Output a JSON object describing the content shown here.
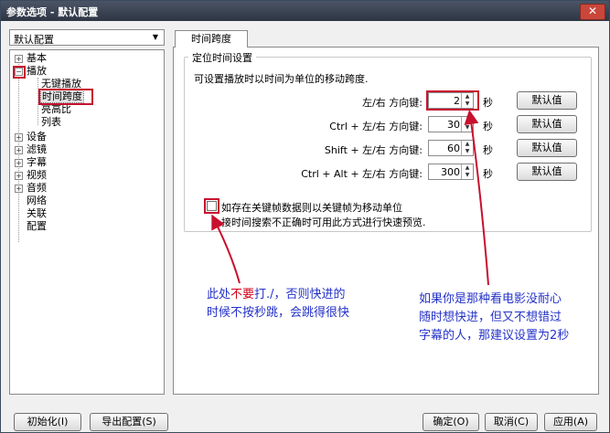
{
  "window": {
    "title": "参数选项 - 默认配置"
  },
  "profile_select": {
    "value": "默认配置"
  },
  "tree": {
    "basic": "基本",
    "playback": "播放",
    "no_keyframe": "无键播放",
    "time_span": "时间跨度",
    "aspect": "亮高比",
    "list": "列表",
    "device": "设备",
    "filter": "滤镜",
    "subtitle": "字幕",
    "video": "视频",
    "audio": "音频",
    "network": "网络",
    "association": "关联",
    "config": "配置"
  },
  "tab": {
    "label": "时间跨度"
  },
  "group": {
    "title": "定位时间设置",
    "description": "可设置播放时以时间为单位的移动跨度.",
    "rows": [
      {
        "label": "左/右 方向键:",
        "value": "2",
        "unit": "秒",
        "button": "默认值"
      },
      {
        "label": "Ctrl + 左/右 方向键:",
        "value": "30",
        "unit": "秒",
        "button": "默认值"
      },
      {
        "label": "Shift + 左/右 方向键:",
        "value": "60",
        "unit": "秒",
        "button": "默认值"
      },
      {
        "label": "Ctrl + Alt + 左/右 方向键:",
        "value": "300",
        "unit": "秒",
        "button": "默认值"
      }
    ],
    "checkbox_label": "如存在关键帧数据则以关键帧为移动单位",
    "checkbox_hint": "接时间搜索不正确时可用此方式进行快速预览."
  },
  "annotations": {
    "left_line1_a": "此处",
    "left_line1_red": "不要",
    "left_line1_b": "打./，否则快进的",
    "left_line2": "时候不按秒跳，会跳得很快",
    "right_line1": "如果你是那种看电影没耐心",
    "right_line2": "随时想快进，但又不想错过",
    "right_line3": "字幕的人，那建议设置为2秒"
  },
  "footer": {
    "init": "初始化(I)",
    "export": "导出配置(S)",
    "ok": "确定(O)",
    "cancel": "取消(C)",
    "apply": "应用(A)"
  },
  "colors": {
    "highlight": "#c8102e",
    "note": "#2432c8"
  }
}
